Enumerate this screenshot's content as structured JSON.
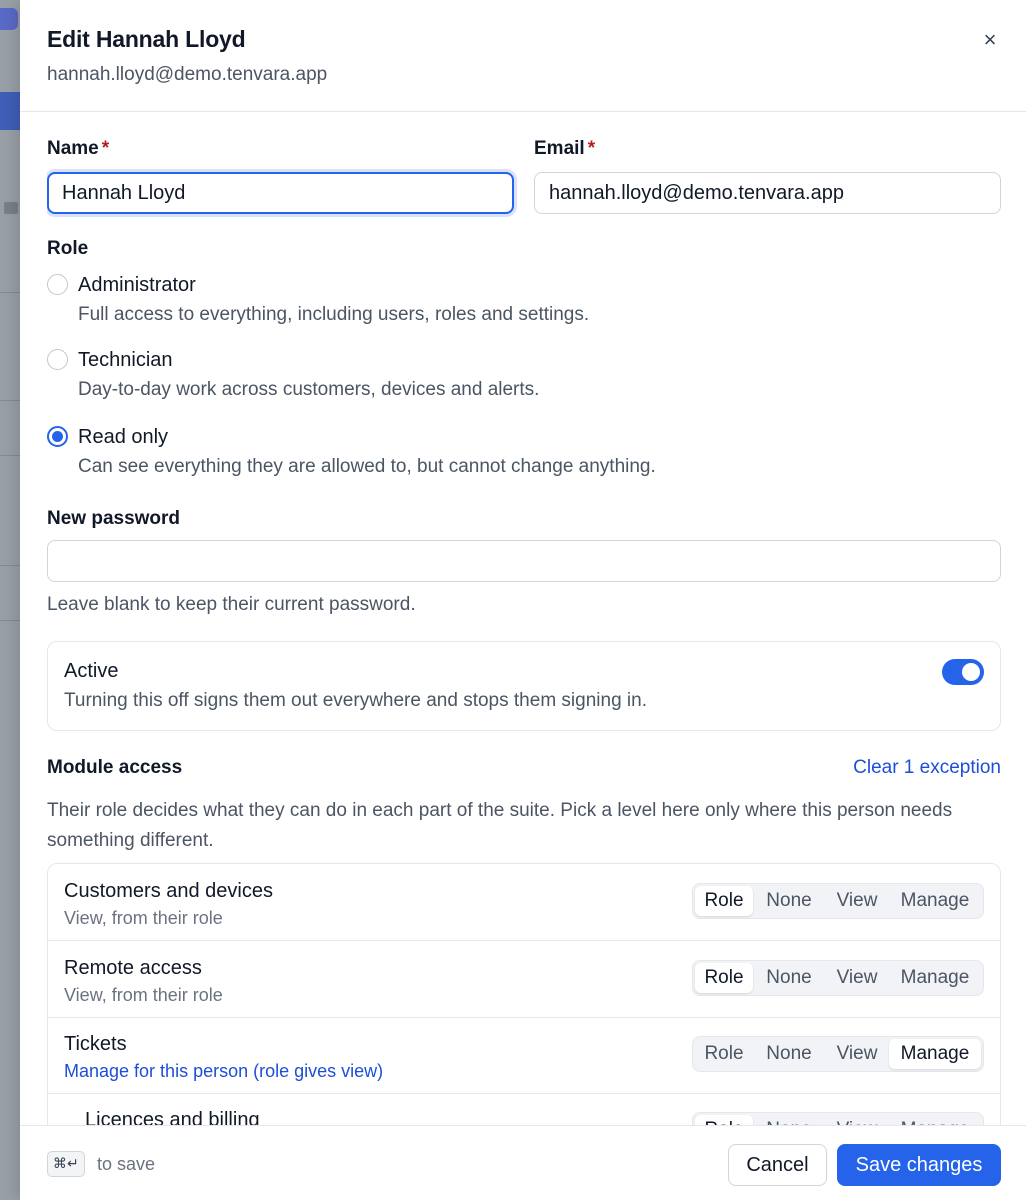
{
  "drawer": {
    "title": "Edit Hannah Lloyd",
    "subtitle": "hannah.lloyd@demo.tenvara.app",
    "close_glyph": "×"
  },
  "form": {
    "name_label": "Name",
    "email_label": "Email",
    "required_mark": "*",
    "name_value": "Hannah Lloyd",
    "email_value": "hannah.lloyd@demo.tenvara.app",
    "role_label": "Role",
    "roles": [
      {
        "label": "Administrator",
        "description": "Full access to everything, including users, roles and settings.",
        "selected": false
      },
      {
        "label": "Technician",
        "description": "Day-to-day work across customers, devices and alerts.",
        "selected": false
      },
      {
        "label": "Read only",
        "description": "Can see everything they are allowed to, but cannot change anything.",
        "selected": true
      }
    ],
    "password_label": "New password",
    "password_value": "",
    "password_hint": "Leave blank to keep their current password.",
    "active": {
      "title": "Active",
      "description": "Turning this off signs them out everywhere and stops them signing in.",
      "enabled": true
    }
  },
  "module_access": {
    "title": "Module access",
    "clear_link": "Clear 1 exception",
    "description": "Their role decides what they can do in each part of the suite. Pick a level here only where this person needs something different.",
    "options": [
      "Role",
      "None",
      "View",
      "Manage"
    ],
    "modules": [
      {
        "name": "Customers and devices",
        "sub": "View, from their role",
        "selected": "Role"
      },
      {
        "name": "Remote access",
        "sub": "View, from their role",
        "selected": "Role"
      },
      {
        "name": "Tickets",
        "sub": "Manage for this person (role gives view)",
        "selected": "Manage"
      },
      {
        "name": "Licences and billing",
        "sub": "",
        "selected": "Role"
      }
    ]
  },
  "footer": {
    "shortcut": "⌘↵",
    "shortcut_text": "to save",
    "cancel_label": "Cancel",
    "save_label": "Save changes"
  },
  "colors": {
    "accent": "#2563eb",
    "link": "#1d4ed8",
    "required": "#b91c1c"
  }
}
